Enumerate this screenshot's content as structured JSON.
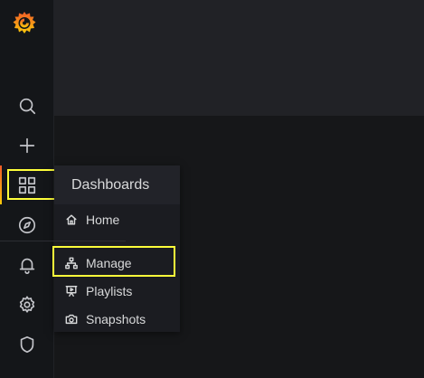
{
  "sidebar": {
    "logo": "grafana-logo-icon",
    "items": [
      {
        "icon": "search-icon"
      },
      {
        "icon": "plus-icon"
      },
      {
        "icon": "dashboards-grid-icon"
      },
      {
        "icon": "compass-icon"
      },
      {
        "icon": "bell-icon"
      },
      {
        "icon": "gear-icon"
      },
      {
        "icon": "shield-icon"
      }
    ],
    "accent_gradient": [
      "#f05a28",
      "#fbca0a"
    ]
  },
  "dashboards_menu": {
    "title": "Dashboards",
    "items": [
      {
        "label": "Home",
        "icon": "home-icon"
      },
      {
        "label": "Manage",
        "icon": "sitemap-icon"
      },
      {
        "label": "Playlists",
        "icon": "presentation-icon"
      },
      {
        "label": "Snapshots",
        "icon": "camera-icon"
      }
    ]
  },
  "highlight_color": "#ffff3a"
}
